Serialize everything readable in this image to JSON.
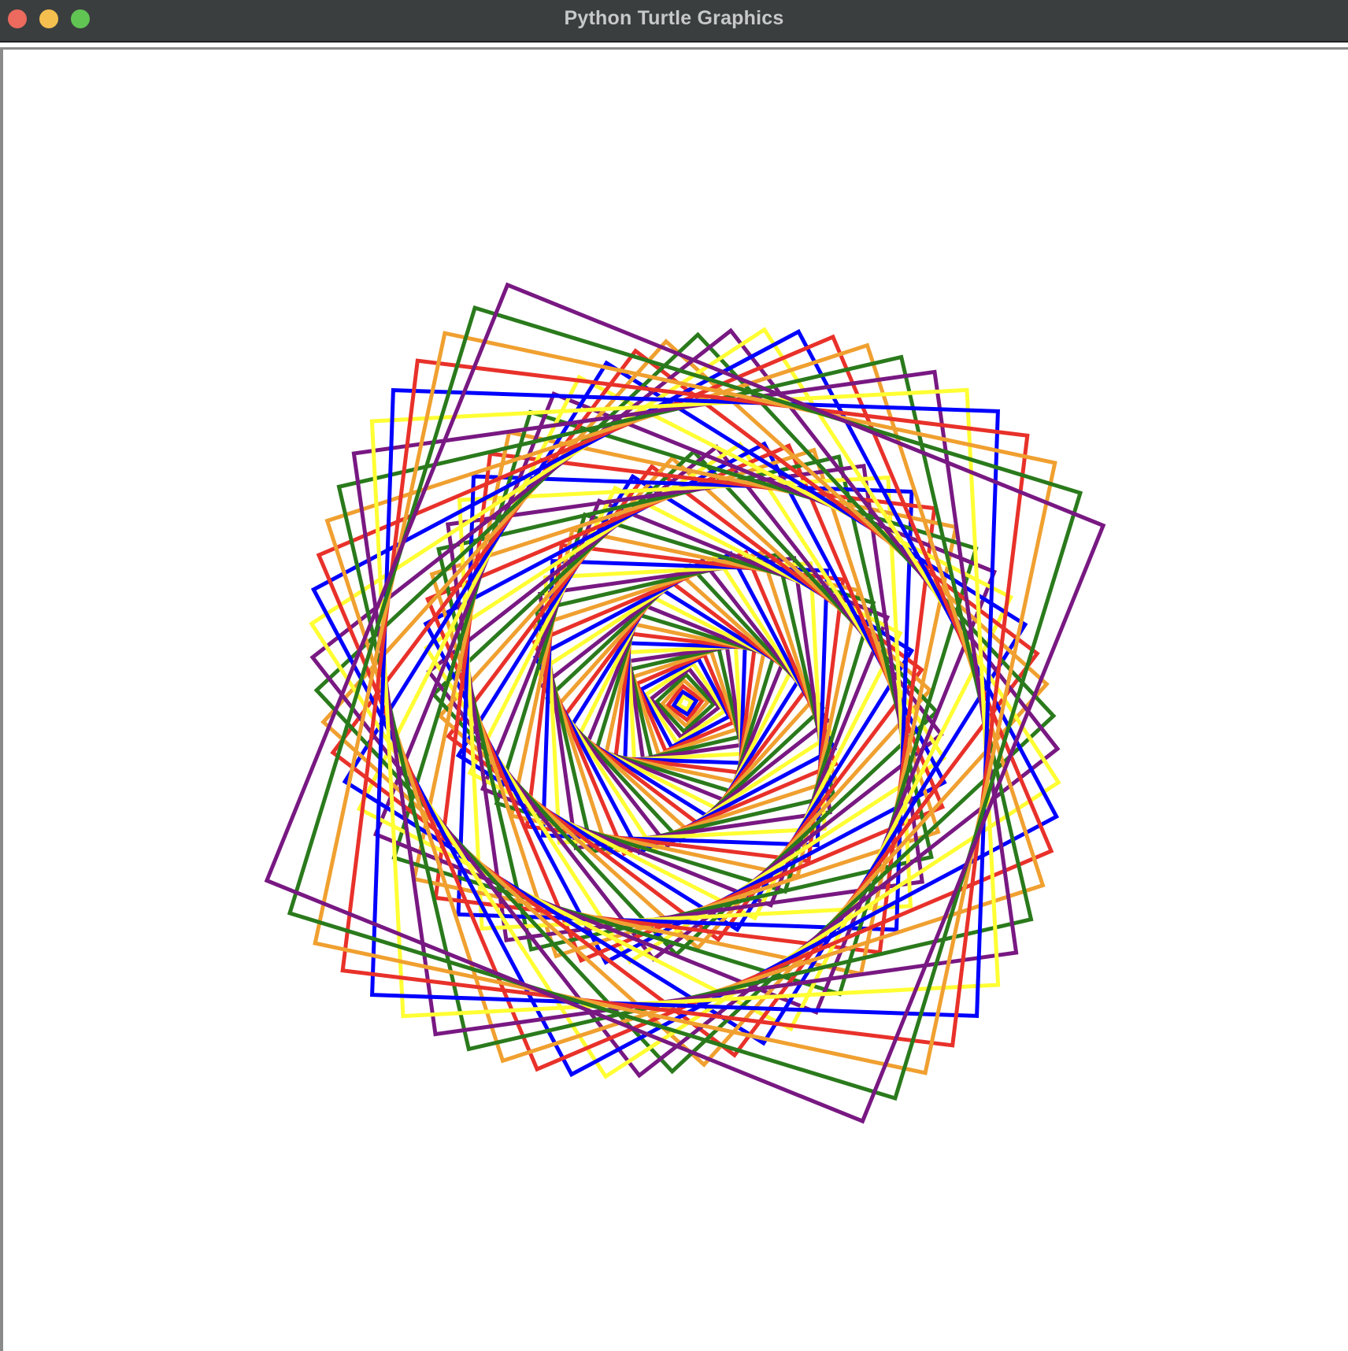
{
  "window": {
    "title": "Python Turtle Graphics",
    "buttons": [
      "close",
      "minimize",
      "zoom"
    ]
  },
  "drawing": {
    "pen_colors": [
      "#ffff33",
      "#0000ff",
      "#e8312a",
      "#f0a030",
      "#2a7a1c",
      "#781882"
    ],
    "shape": "square",
    "pattern": "rotating square spiral",
    "background": "#ffffff"
  }
}
